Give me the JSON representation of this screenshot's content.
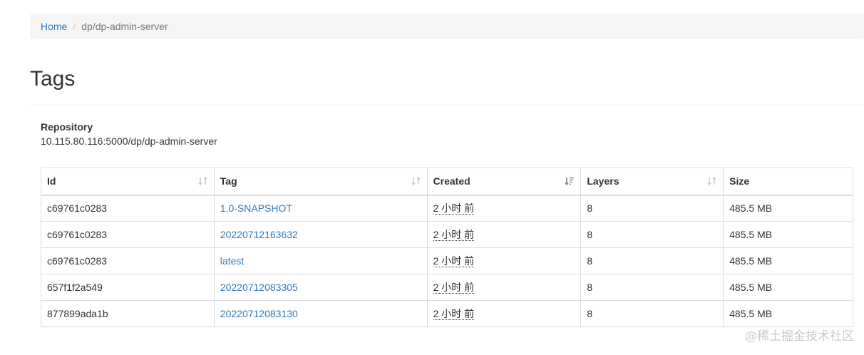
{
  "breadcrumb": {
    "home": "Home",
    "separator": "/",
    "current": "dp/dp-admin-server"
  },
  "page": {
    "title": "Tags"
  },
  "repository": {
    "label": "Repository",
    "value": "10.115.80.116:5000/dp/dp-admin-server"
  },
  "table": {
    "headers": {
      "id": "Id",
      "tag": "Tag",
      "created": "Created",
      "layers": "Layers",
      "size": "Size"
    },
    "rows": [
      {
        "id": "c69761c0283",
        "tag": "1.0-SNAPSHOT",
        "created": "2 小时 前",
        "layers": "8",
        "size": "485.5 MB"
      },
      {
        "id": "c69761c0283",
        "tag": "20220712163632",
        "created": "2 小时 前",
        "layers": "8",
        "size": "485.5 MB"
      },
      {
        "id": "c69761c0283",
        "tag": "latest",
        "created": "2 小时 前",
        "layers": "8",
        "size": "485.5 MB"
      },
      {
        "id": "657f1f2a549",
        "tag": "20220712083305",
        "created": "2 小时 前",
        "layers": "8",
        "size": "485.5 MB"
      },
      {
        "id": "877899ada1b",
        "tag": "20220712083130",
        "created": "2 小时 前",
        "layers": "8",
        "size": "485.5 MB"
      }
    ]
  },
  "watermark": "@稀土掘金技术社区",
  "colors": {
    "link": "#337ab7",
    "sort_icon": "#cccccc",
    "sort_icon_active": "#888888"
  }
}
